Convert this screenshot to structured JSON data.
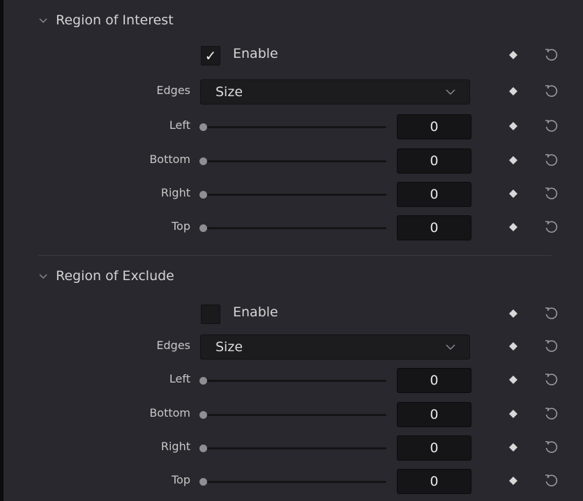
{
  "sections": [
    {
      "title": "Region of Interest",
      "enable": {
        "label": "Enable",
        "checked": true,
        "mark": "✓"
      },
      "edges": {
        "label": "Edges",
        "value": "Size"
      },
      "sliders": [
        {
          "label": "Left",
          "value": "0"
        },
        {
          "label": "Bottom",
          "value": "0"
        },
        {
          "label": "Right",
          "value": "0"
        },
        {
          "label": "Top",
          "value": "0"
        }
      ]
    },
    {
      "title": "Region of Exclude",
      "enable": {
        "label": "Enable",
        "checked": false,
        "mark": ""
      },
      "edges": {
        "label": "Edges",
        "value": "Size"
      },
      "sliders": [
        {
          "label": "Left",
          "value": "0"
        },
        {
          "label": "Bottom",
          "value": "0"
        },
        {
          "label": "Right",
          "value": "0"
        },
        {
          "label": "Top",
          "value": "0"
        }
      ]
    }
  ],
  "icons": {
    "collapse": "chevron-down-icon",
    "dropdown": "chevron-down-icon",
    "keyframe": "diamond-keyframe-icon",
    "reset": "reset-arrow-icon"
  },
  "colors": {
    "background": "#28282e",
    "field": "#151517",
    "text": "#d6d6d6"
  }
}
